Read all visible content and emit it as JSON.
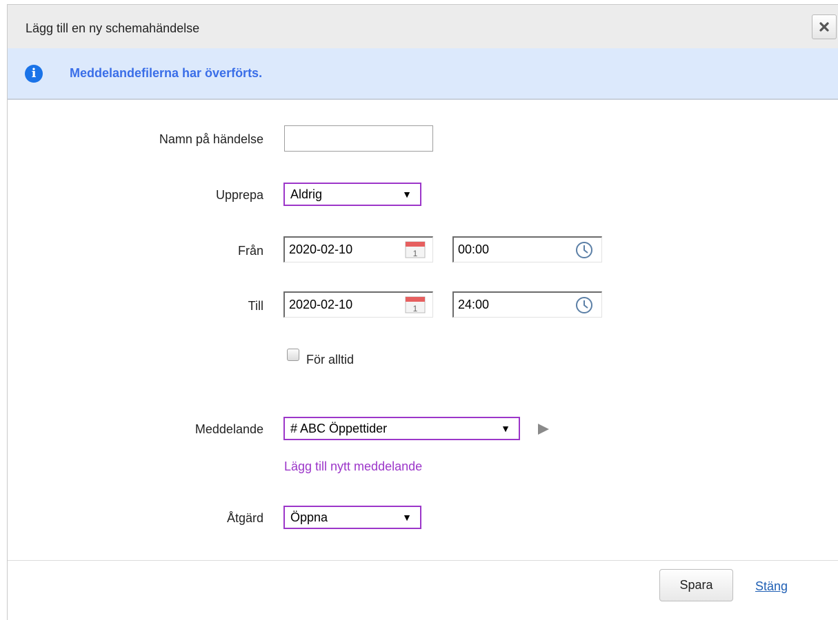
{
  "dialog": {
    "title": "Lägg till en ny schemahändelse",
    "close_icon": "close-x-icon"
  },
  "info": {
    "icon": "info-icon",
    "message": "Meddelandefilerna har överförts."
  },
  "form": {
    "event_name_label": "Namn på händelse",
    "event_name_value": "",
    "repeat_label": "Upprepa",
    "repeat_value": "Aldrig",
    "from_label": "Från",
    "from_date": "2020-02-10",
    "from_time": "00:00",
    "to_label": "Till",
    "to_date": "2020-02-10",
    "to_time": "24:00",
    "forever_label": "För alltid",
    "forever_checked": false,
    "message_label": "Meddelande",
    "message_value": "# ABC Öppettider",
    "add_message_link": "Lägg till nytt meddelande",
    "action_label": "Åtgärd",
    "action_value": "Öppna"
  },
  "footer": {
    "save_label": "Spara",
    "close_label": "Stäng"
  },
  "colors": {
    "accent_purple": "#9c36c9",
    "info_bg": "#dce9fc",
    "info_text": "#3a6ee8",
    "link_blue": "#1f5fb4"
  }
}
